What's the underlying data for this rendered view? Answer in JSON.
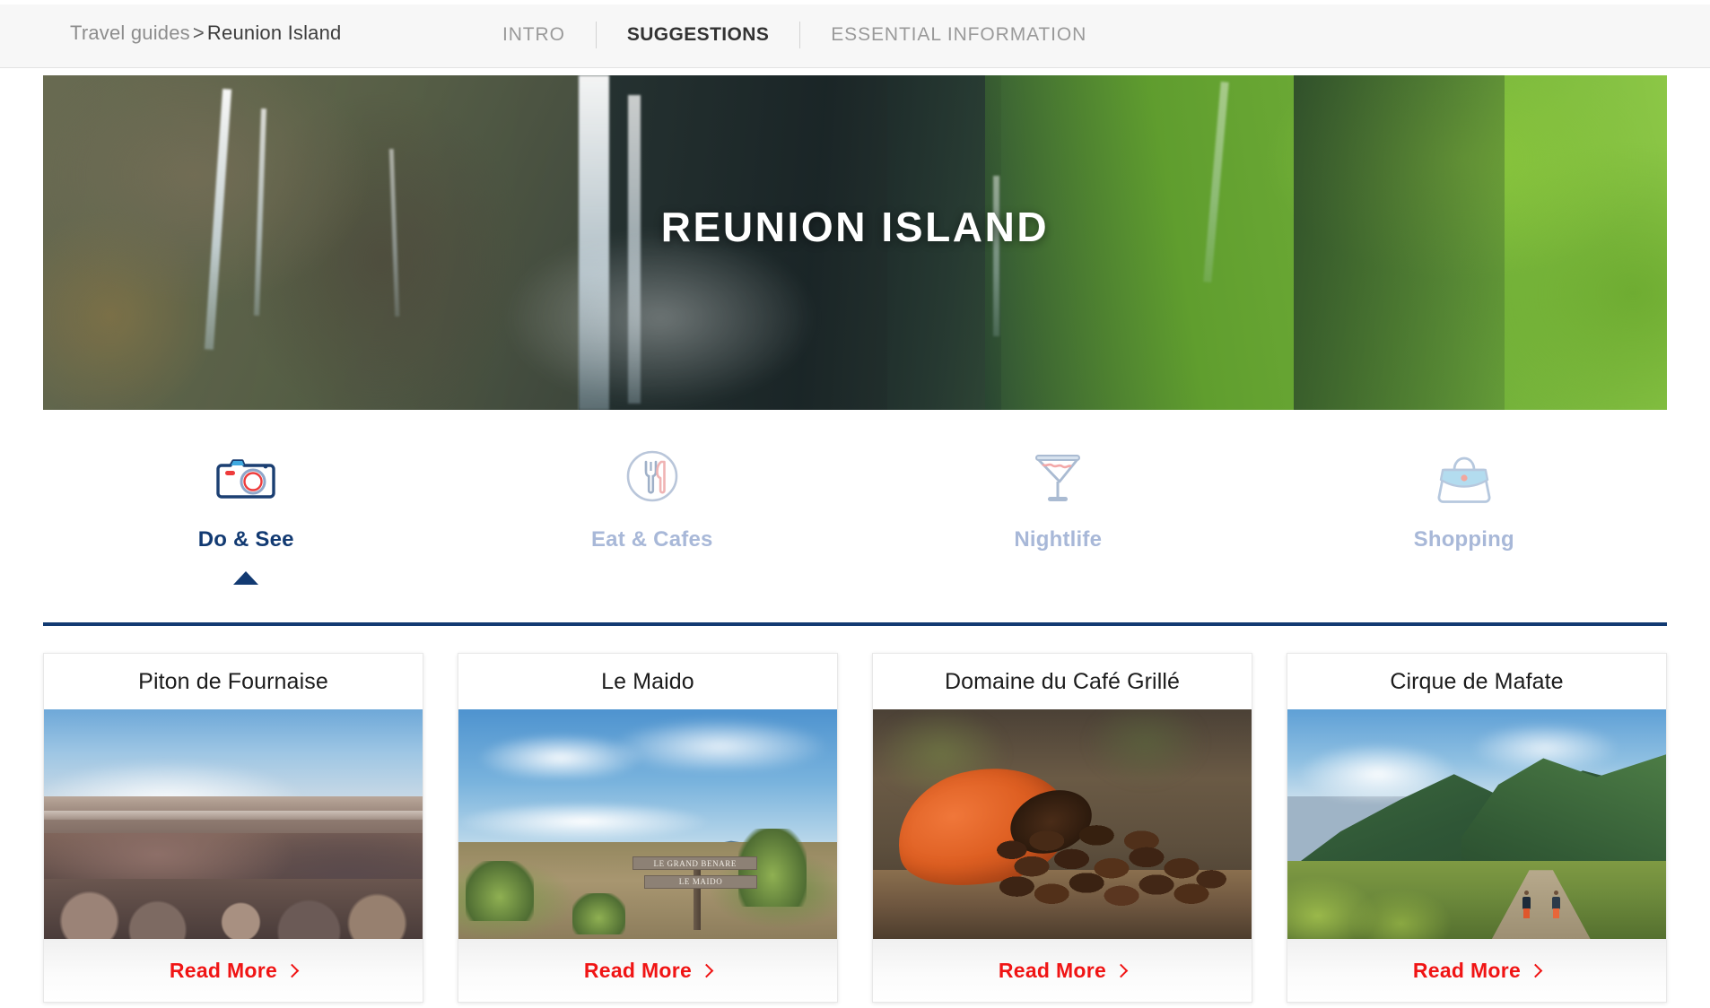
{
  "topbar": {
    "breadcrumb": {
      "root": "Travel guides",
      "separator": ">",
      "leaf": "Reunion Island"
    },
    "tabs": [
      {
        "label": "INTRO",
        "active": false
      },
      {
        "label": "SUGGESTIONS",
        "active": true
      },
      {
        "label": "ESSENTIAL INFORMATION",
        "active": false
      }
    ]
  },
  "hero": {
    "title": "REUNION ISLAND",
    "alt": "Waterfalls cascading down lush green cliffs"
  },
  "categories": [
    {
      "label": "Do & See",
      "icon": "camera-icon",
      "active": true
    },
    {
      "label": "Eat & Cafes",
      "icon": "cutlery-icon",
      "active": false
    },
    {
      "label": "Nightlife",
      "icon": "cocktail-icon",
      "active": false
    },
    {
      "label": "Shopping",
      "icon": "handbag-icon",
      "active": false
    }
  ],
  "cards": [
    {
      "title": "Piton de Fournaise",
      "cta": "Read More"
    },
    {
      "title": "Le Maido",
      "cta": "Read More",
      "sign_top": "LE GRAND BENARE",
      "sign_bottom": "LE MAIDO"
    },
    {
      "title": "Domaine du Café Grillé",
      "cta": "Read More"
    },
    {
      "title": "Cirque de Mafate",
      "cta": "Read More"
    }
  ],
  "colors": {
    "accent_navy": "#123a72",
    "accent_red": "#f01414",
    "inactive_blue": "#a8b8d8",
    "topbar_bg": "#f7f7f7"
  }
}
